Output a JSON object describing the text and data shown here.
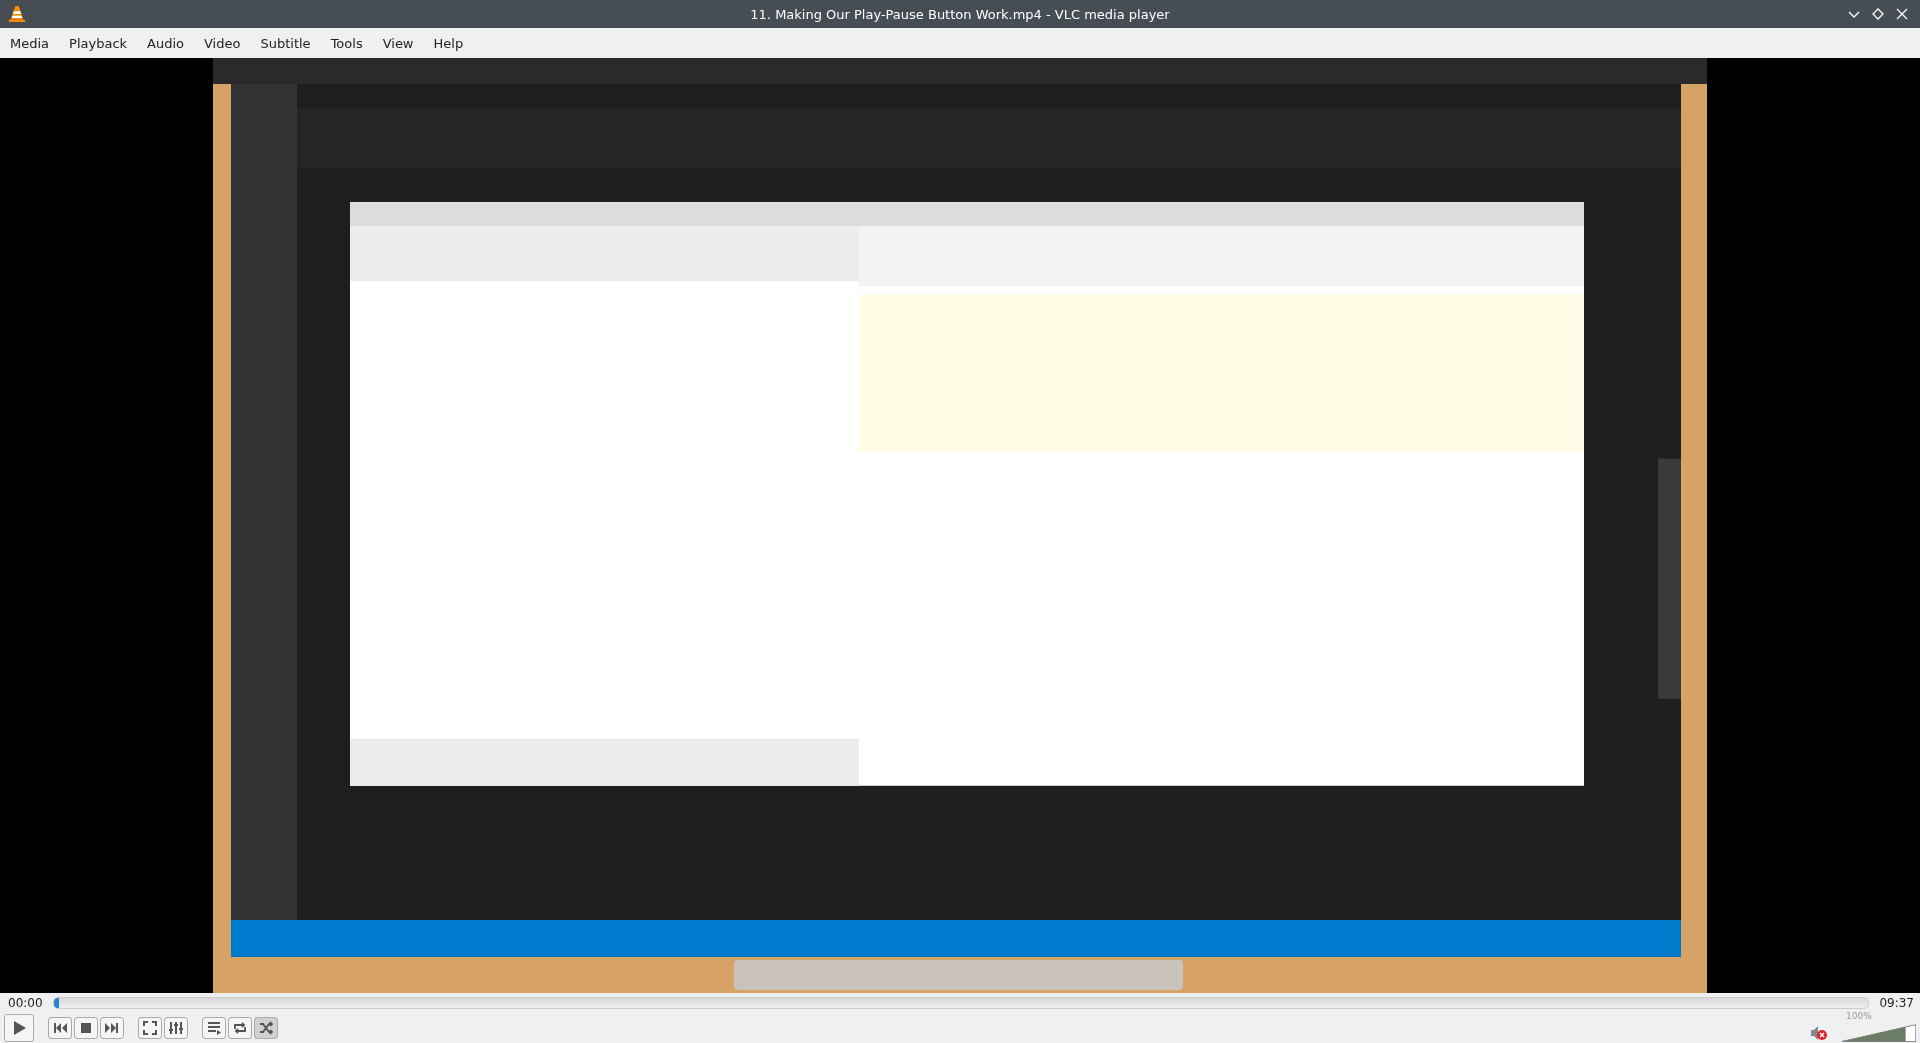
{
  "window": {
    "title": "11. Making Our Play-Pause Button Work.mp4 - VLC media player"
  },
  "menu": [
    "Media",
    "Playback",
    "Audio",
    "Video",
    "Subtitle",
    "Tools",
    "View",
    "Help"
  ],
  "video": {
    "kind": "picture"
  },
  "seek": {
    "elapsed": "00:00",
    "total": "09:37",
    "level": 0.003
  },
  "controls": [
    {
      "kind": "play",
      "on": false
    },
    {
      "kind": "previous",
      "on": false
    },
    {
      "kind": "stop",
      "on": false
    },
    {
      "kind": "next",
      "on": false
    },
    {
      "kind": "fullscreen",
      "on": false
    },
    {
      "kind": "settings",
      "on": false
    },
    {
      "kind": "playlist",
      "on": false
    },
    {
      "kind": "loop",
      "on": false
    },
    {
      "kind": "shuffle",
      "on": true
    }
  ],
  "volume": {
    "muted": true,
    "level": 0.86,
    "reading": "100%"
  }
}
